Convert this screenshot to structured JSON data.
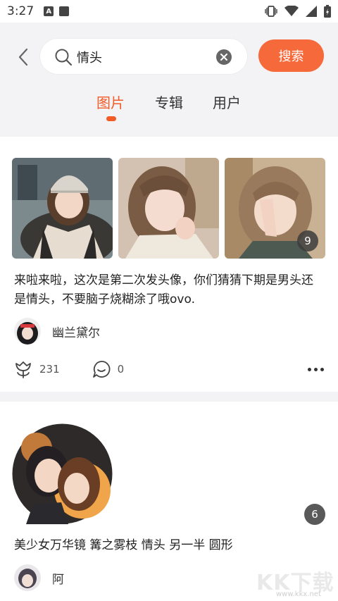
{
  "status_bar": {
    "time": "3:27"
  },
  "search": {
    "query": "情头",
    "button_label": "搜索"
  },
  "tabs": [
    {
      "label": "图片",
      "active": true
    },
    {
      "label": "专辑",
      "active": false
    },
    {
      "label": "用户",
      "active": false
    }
  ],
  "posts": [
    {
      "image_count": "9",
      "description": "来啦来啦，这次是第二次发头像，你们猜猜下期是男头还是情头，不要脑子烧糊涂了哦ovo.",
      "author": "幽兰黛尔",
      "likes": "231",
      "comments": "0"
    },
    {
      "image_count": "6",
      "description": "美少女万华镜 篝之雾枝 情头 另一半 圆形",
      "author": "阿"
    }
  ],
  "watermark": {
    "text": "KK下载",
    "url": "www.kkx.net"
  },
  "colors": {
    "accent": "#f25a26",
    "search_button": "#f6693a"
  }
}
